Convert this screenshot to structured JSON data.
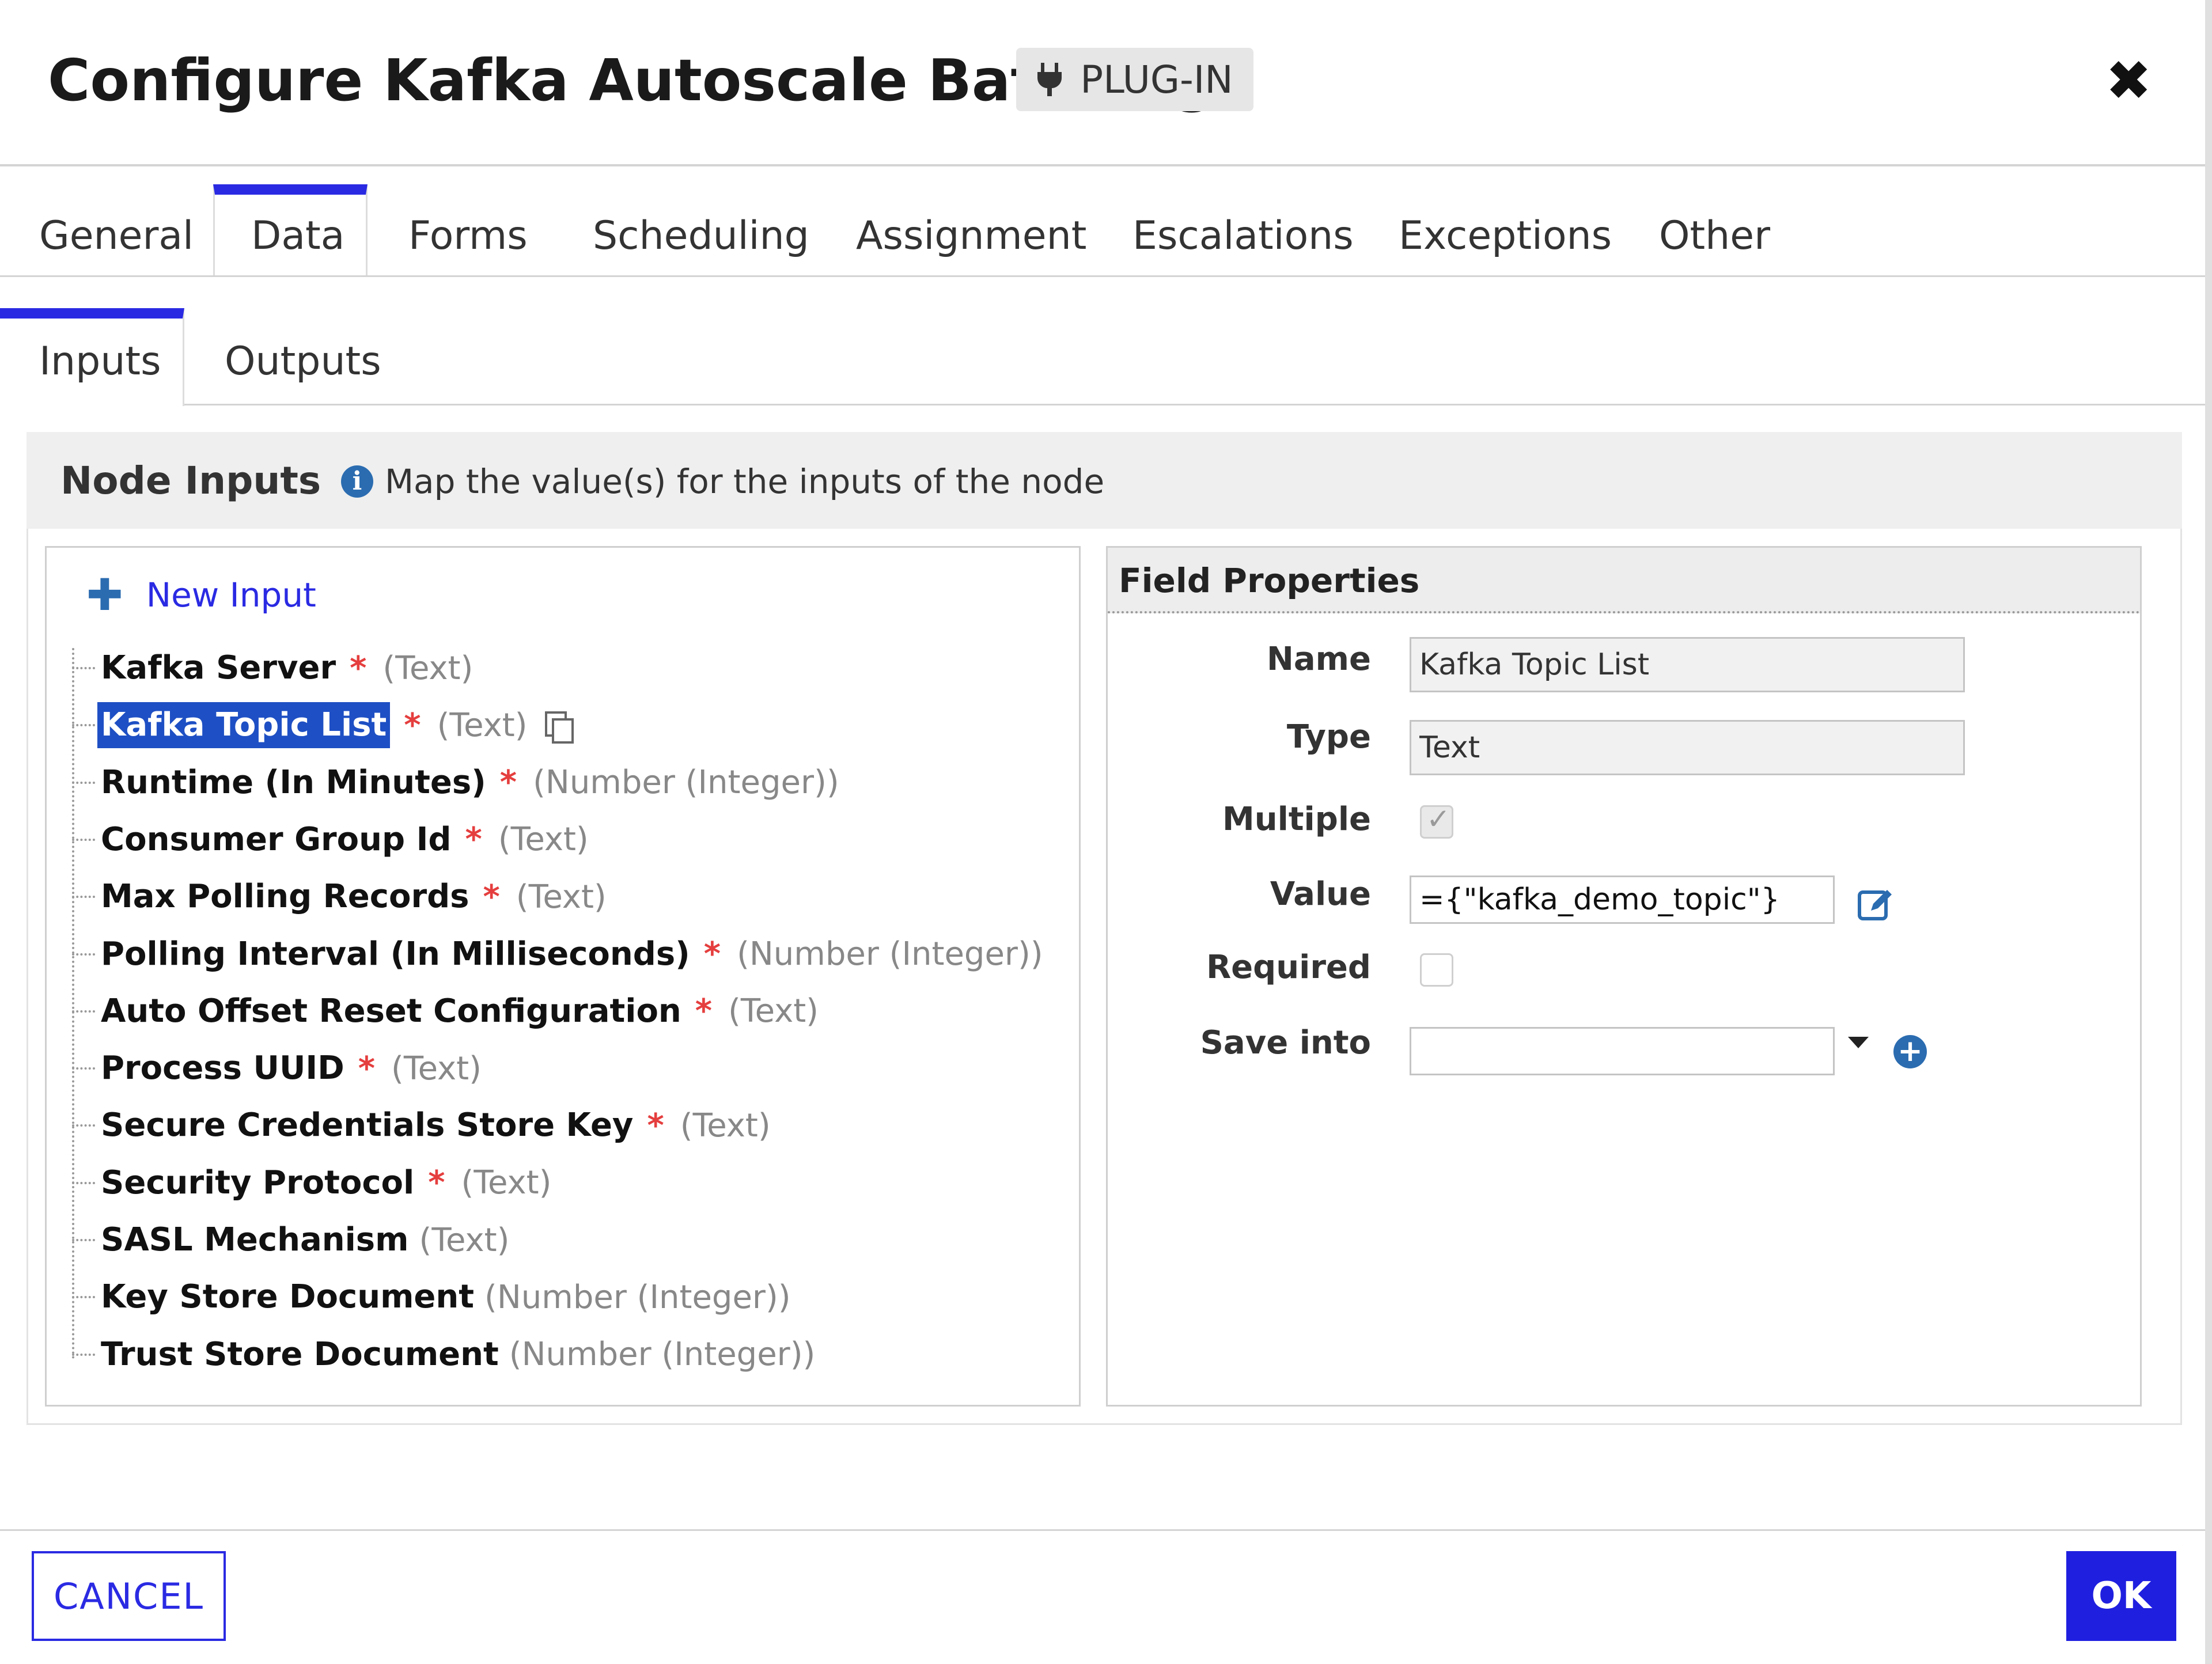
{
  "header": {
    "title": "Configure Kafka Autoscale Batching",
    "badge_label": "PLUG-IN",
    "badge_icon": "plug-icon",
    "close_icon": "close-icon"
  },
  "tabs": [
    {
      "label": "General"
    },
    {
      "label": "Data",
      "active": true
    },
    {
      "label": "Forms"
    },
    {
      "label": "Scheduling"
    },
    {
      "label": "Assignment"
    },
    {
      "label": "Escalations"
    },
    {
      "label": "Exceptions"
    },
    {
      "label": "Other"
    }
  ],
  "subtabs": [
    {
      "label": "Inputs",
      "active": true
    },
    {
      "label": "Outputs"
    }
  ],
  "node_inputs": {
    "title": "Node Inputs",
    "hint": "Map the value(s) for the inputs of the node",
    "new_input_label": "New Input",
    "items": [
      {
        "name": "Kafka Server",
        "required": "*",
        "type": "(Text)"
      },
      {
        "name": "Kafka Topic List",
        "required": "*",
        "type": "(Text)",
        "selected": true
      },
      {
        "name": "Runtime (In Minutes)",
        "required": "*",
        "type": "(Number (Integer))"
      },
      {
        "name": "Consumer Group Id",
        "required": "*",
        "type": "(Text)"
      },
      {
        "name": "Max Polling Records",
        "required": "*",
        "type": "(Text)"
      },
      {
        "name": "Polling Interval (In Milliseconds)",
        "required": "*",
        "type": "(Number (Integer))"
      },
      {
        "name": "Auto Offset Reset Configuration",
        "required": "*",
        "type": "(Text)"
      },
      {
        "name": "Process UUID",
        "required": "*",
        "type": "(Text)"
      },
      {
        "name": "Secure Credentials Store Key",
        "required": "*",
        "type": "(Text)"
      },
      {
        "name": "Security Protocol",
        "required": "*",
        "type": "(Text)"
      },
      {
        "name": "SASL Mechanism",
        "required": "",
        "type": "(Text)"
      },
      {
        "name": "Key Store Document",
        "required": "",
        "type": "(Number (Integer))"
      },
      {
        "name": "Trust Store Document",
        "required": "",
        "type": "(Number (Integer))"
      }
    ]
  },
  "field_properties": {
    "title": "Field Properties",
    "name_label": "Name",
    "name_value": "Kafka Topic List",
    "type_label": "Type",
    "type_value": "Text",
    "multiple_label": "Multiple",
    "multiple_checked": true,
    "value_label": "Value",
    "value_value": "={\"kafka_demo_topic\"}",
    "required_label": "Required",
    "required_checked": false,
    "save_into_label": "Save into",
    "save_into_value": ""
  },
  "footer": {
    "cancel_label": "CANCEL",
    "ok_label": "OK"
  },
  "colors": {
    "accent": "#2a2ae3",
    "selection": "#1e4fc4",
    "required": "#e53e3e",
    "info": "#2b6cb0"
  }
}
